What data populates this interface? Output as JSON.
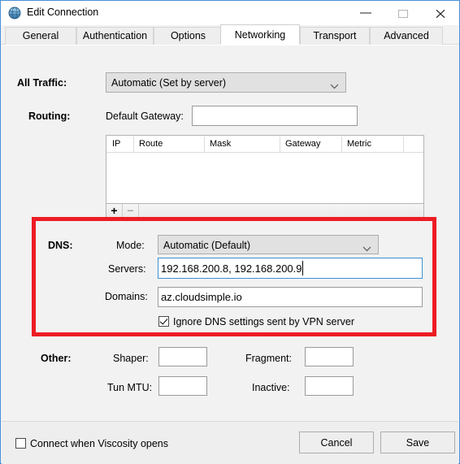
{
  "window": {
    "title": "Edit Connection",
    "icon": "globe-icon",
    "controls": {
      "minimize": "minimize-icon",
      "maximize": "maximize-icon",
      "close": "close-icon"
    }
  },
  "tabs": [
    {
      "label": "General",
      "active": false
    },
    {
      "label": "Authentication",
      "active": false
    },
    {
      "label": "Options",
      "active": false
    },
    {
      "label": "Networking",
      "active": true
    },
    {
      "label": "Transport",
      "active": false
    },
    {
      "label": "Advanced",
      "active": false
    }
  ],
  "all_traffic": {
    "label": "All Traffic:",
    "value": "Automatic (Set by server)",
    "chevron": "chevron-down-icon"
  },
  "routing": {
    "label": "Routing:",
    "gateway_label": "Default Gateway:",
    "gateway_value": "",
    "gateway_placeholder": "",
    "table": {
      "columns": [
        "IP",
        "Route",
        "Mask",
        "Gateway",
        "Metric"
      ],
      "rows": []
    },
    "add_button": "+",
    "remove_button": "−"
  },
  "dns": {
    "label": "DNS:",
    "mode_label": "Mode:",
    "mode_value": "Automatic (Default)",
    "mode_chevron": "chevron-down-icon",
    "servers_label": "Servers:",
    "servers_value": "192.168.200.8, 192.168.200.9",
    "domains_label": "Domains:",
    "domains_value": "az.cloudsimple.io",
    "ignore_checkbox_label": "Ignore DNS settings sent by VPN server",
    "ignore_checkbox_checked": true,
    "highlight_color": "#ed1c24"
  },
  "other": {
    "label": "Other:",
    "shaper_label": "Shaper:",
    "shaper_value": "",
    "fragment_label": "Fragment:",
    "fragment_value": "",
    "tun_mtu_label": "Tun MTU:",
    "tun_mtu_value": "",
    "inactive_label": "Inactive:",
    "inactive_value": ""
  },
  "footer": {
    "connect_checkbox_label": "Connect when Viscosity opens",
    "connect_checkbox_checked": false,
    "cancel_label": "Cancel",
    "save_label": "Save"
  }
}
